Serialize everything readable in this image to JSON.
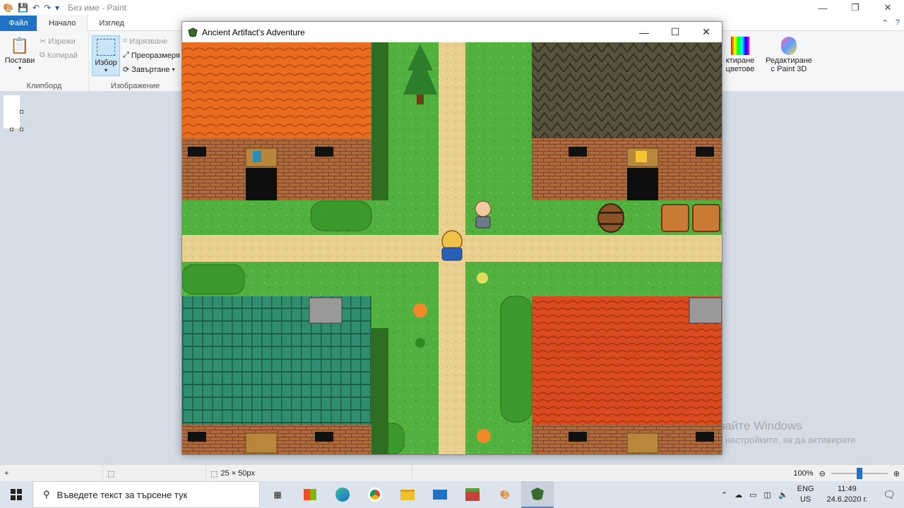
{
  "paint": {
    "title": "Без име - Paint",
    "tabs": [
      "Файл",
      "Начало",
      "Изглед"
    ],
    "clipboard": {
      "paste": "Постави",
      "cut": "Изрежи",
      "copy": "Копирай",
      "group": "Клипборд"
    },
    "image": {
      "select": "Избор",
      "crop": "Изрязване",
      "resize": "Преоразмеря",
      "rotate": "Завъртане",
      "group": "Изображение"
    },
    "edit_colors": [
      "ктиране",
      "цветове"
    ],
    "paint3d": [
      "Редактиране",
      "с Paint 3D"
    ],
    "status": {
      "selection_size": "25 × 50px",
      "zoom": "100%"
    }
  },
  "watermark": {
    "line1": "Активирайте Windows",
    "line2": "Отидете в настройките, за да активирате"
  },
  "game": {
    "title": "Ancient Artifact's Adventure"
  },
  "taskbar": {
    "search_placeholder": "Въведете текст за търсене тук",
    "lang": "ENG",
    "region": "US",
    "time": "11:49",
    "date": "24.6.2020 г."
  },
  "colors": {
    "accent": "#1e73c6",
    "grass": "#4caf3a",
    "path": "#e8cf8e",
    "orange_roof": "#e86a1e",
    "teal_roof": "#2e8a6e",
    "red_roof": "#d9481f",
    "stone_roof": "#4a4a3a",
    "brick": "#a8643a"
  }
}
